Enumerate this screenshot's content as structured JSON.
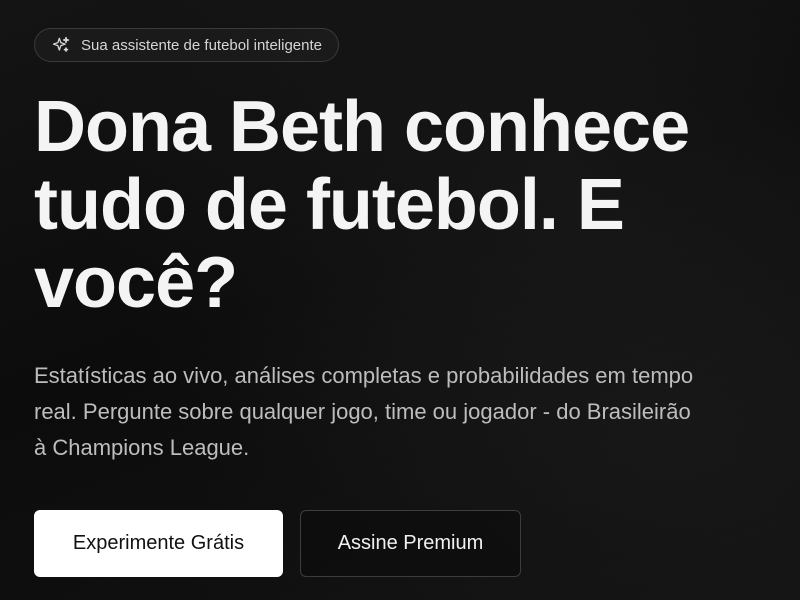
{
  "badge": {
    "icon": "sparkles-icon",
    "text": "Sua assistente de futebol inteligente"
  },
  "hero": {
    "headline": "Dona Beth conhece tudo de futebol. E você?",
    "subtitle_lines": [
      "Estatísticas ao vivo, análises completas e probabilidades em tempo",
      "real. Pergunte sobre qualquer jogo, time ou jogador - do Brasileirão",
      "à Champions League."
    ]
  },
  "actions": {
    "primary_label": "Experimente Grátis",
    "secondary_label": "Assine Premium"
  },
  "colors": {
    "background": "#0d0d0d",
    "primary_button_bg": "#ffffff",
    "primary_button_text": "#111111",
    "text": "#f4f4f4"
  }
}
